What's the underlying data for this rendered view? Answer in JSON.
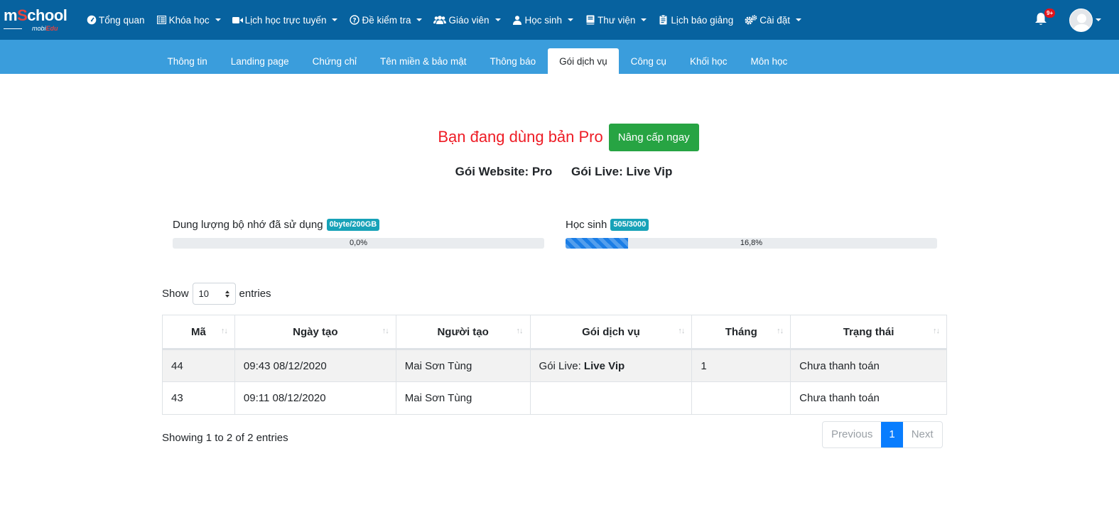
{
  "brand": {
    "name_prefix": "m",
    "name_s": "S",
    "name_suffix": "chool",
    "tag_prefix": "mobi",
    "tag_suffix": "Edu"
  },
  "nav": {
    "items": [
      {
        "label": "Tổng quan",
        "icon": "dashboard-icon",
        "dropdown": false
      },
      {
        "label": "Khóa học",
        "icon": "list-icon",
        "dropdown": true
      },
      {
        "label": "Lịch học trực tuyến",
        "icon": "video-icon",
        "dropdown": true
      },
      {
        "label": "Đề kiểm tra",
        "icon": "question-circle-icon",
        "dropdown": true
      },
      {
        "label": "Giáo viên",
        "icon": "users-icon",
        "dropdown": true
      },
      {
        "label": "Học sinh",
        "icon": "user-icon",
        "dropdown": true
      },
      {
        "label": "Thư viện",
        "icon": "book-icon",
        "dropdown": true
      },
      {
        "label": "Lịch báo giảng",
        "icon": "clipboard-icon",
        "dropdown": false
      },
      {
        "label": "Cài đặt",
        "icon": "cogs-icon",
        "dropdown": true
      }
    ],
    "notification_badge": "9+"
  },
  "tabs": [
    "Thông tin",
    "Landing page",
    "Chứng chỉ",
    "Tên miền & bảo mật",
    "Thông báo",
    "Gói dịch vụ",
    "Công cụ",
    "Khối học",
    "Môn học"
  ],
  "active_tab": "Gói dịch vụ",
  "plan": {
    "title": "Bạn đang dùng bản Pro",
    "upgrade_label": "Nâng cấp ngay",
    "website_package": "Gói Website: Pro",
    "live_package": "Gói Live: Live Vip"
  },
  "usage": {
    "storage": {
      "label": "Dung lượng bộ nhớ đã sử dụng",
      "badge": "0byte/200GB",
      "percent_text": "0,0%",
      "fraction": 0.0
    },
    "students": {
      "label": "Học sinh",
      "badge": "505/3000",
      "percent_text": "16,8%",
      "fraction": 0.168
    }
  },
  "table": {
    "show_label": "Show",
    "page_size": "10",
    "entries_label": "entries",
    "columns": [
      "Mã",
      "Ngày tạo",
      "Người tạo",
      "Gói dịch vụ",
      "Tháng",
      "Trạng thái"
    ],
    "rows": [
      {
        "id": "44",
        "created": "09:43 08/12/2020",
        "creator": "Mai Sơn Tùng",
        "package_prefix": "Gói Live: ",
        "package_name": "Live Vip",
        "months": "1",
        "status": "Chưa thanh toán"
      },
      {
        "id": "43",
        "created": "09:11 08/12/2020",
        "creator": "Mai Sơn Tùng",
        "package_prefix": "",
        "package_name": "",
        "months": "",
        "status": "Chưa thanh toán"
      }
    ],
    "info": "Showing 1 to 2 of 2 entries",
    "pager": {
      "previous": "Previous",
      "current": "1",
      "next": "Next"
    }
  },
  "colors": {
    "navbar": "#07629f",
    "subbar": "#3a9ddc",
    "accent_red": "#ee1c25",
    "upgrade_green": "#27a443",
    "badge_teal": "#17a2b8",
    "pager_blue": "#087dfe"
  }
}
